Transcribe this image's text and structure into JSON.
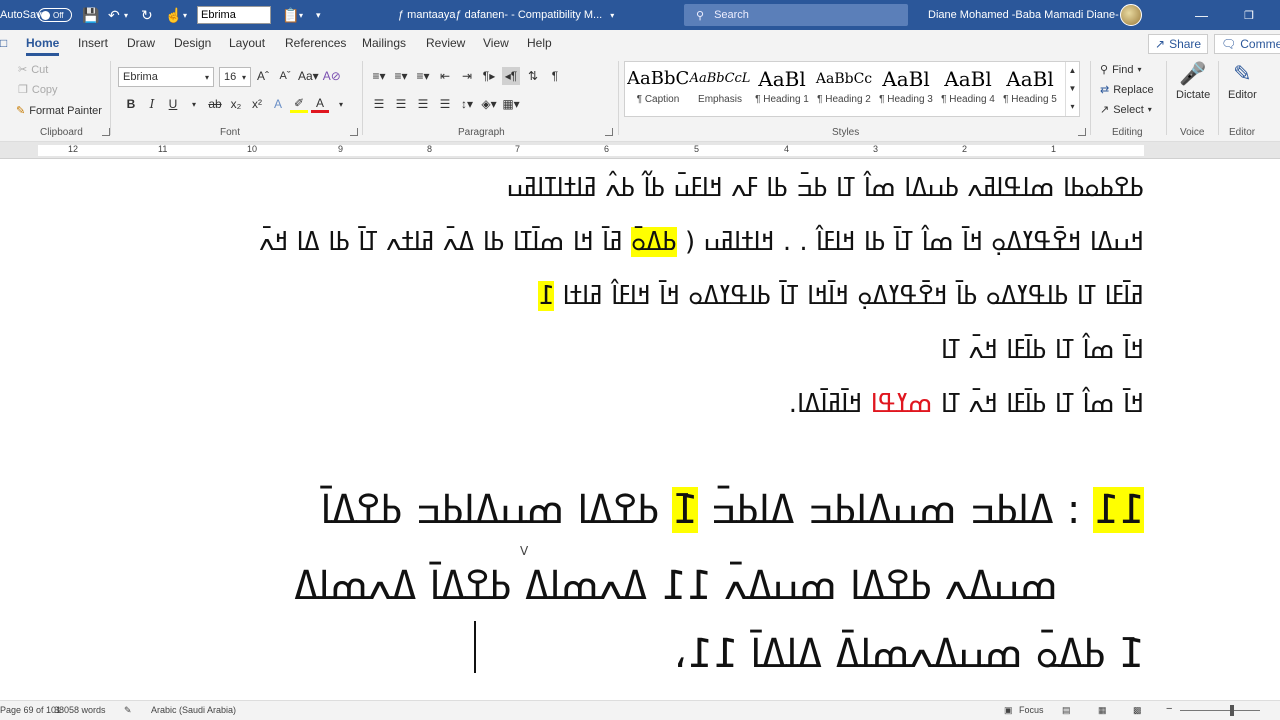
{
  "titlebar": {
    "autosave_label": "AutoSave",
    "autosave_state": "Off",
    "font_box": "Ebrima",
    "doc_title": "ƒ mantaayaƒ dafanen-  -  Compatibility M...",
    "search_placeholder": "Search",
    "user_name": "Diane Mohamed -Baba Mamadi Diane-"
  },
  "tabs": [
    "Home",
    "Insert",
    "Draw",
    "Design",
    "Layout",
    "References",
    "Mailings",
    "Review",
    "View",
    "Help"
  ],
  "share_label": "Share",
  "comments_label": "Comments",
  "clipboard": {
    "cut": "Cut",
    "copy": "Copy",
    "format_painter": "Format Painter",
    "group": "Clipboard"
  },
  "font": {
    "name": "Ebrima",
    "size": "16",
    "group": "Font"
  },
  "paragraph": {
    "group": "Paragraph"
  },
  "styles": {
    "group": "Styles",
    "items": [
      {
        "preview": "AaBbC",
        "name": "¶ Caption"
      },
      {
        "preview": "AaBbCcL",
        "name": "Emphasis"
      },
      {
        "preview": "AaBl",
        "name": "¶ Heading 1"
      },
      {
        "preview": "AaBbCc",
        "name": "¶ Heading 2"
      },
      {
        "preview": "AaBl",
        "name": "¶ Heading 3"
      },
      {
        "preview": "AaBl",
        "name": "¶ Heading 4"
      },
      {
        "preview": "AaBl",
        "name": "¶ Heading 5"
      }
    ]
  },
  "editing": {
    "find": "Find",
    "replace": "Replace",
    "select": "Select",
    "group": "Editing"
  },
  "voice": {
    "dictate": "Dictate",
    "group": "Voice"
  },
  "editor_group": {
    "editor": "Editor",
    "group": "Editor"
  },
  "ruler_numbers": [
    "12",
    "11",
    "10",
    "9",
    "8",
    "7",
    "6",
    "5",
    "4",
    "3",
    "2",
    "1"
  ],
  "document": {
    "para1": [
      "ߕߐߕߋߕߊ ߘߊߟߊߥߍ ߕߎߡߊ ߘߊ߮ ߠߊ ߕߏ߫ ߕߊ ߓߍ ߞߊߓߎ߫ ߕߊ߬ ߕߍ߮ ߥߊߙߊߠߊߥߎ",
      "ߞߎߡߊ ߞߐ߫ߟߌߡߋ߲ ߞߊ߫ ߘߊ߮ ߠߊ߫ ߕߊ ߞߊߓߊ߮ . . ߞߊߙߊߥߎ",
      "ߥߊ߫ ߞߊ ߘߊ߫ߠߊ ߕߊ ߡߍ߫ ߥߊߙߍ ߠߊ߫ ߕߊ ߡߊ ߞߍ߫",
      "ߥߊ߫ߓߊ ߠߊ ߕߊߟߌߡߋ ߕߊ߫ ߞߐ߫ߟߌߡߋ߲ ߞߊ߫ߞߊ ߠߊ߫ ߕߊߟߌߡߋ ߞߊ߫ ߞߊߓߊ߮ ߥߊߙߊ",
      "ߞߊ߫ ߘߊ߮ ߠߊ ߕߊ߫ߓߊ ߞߍ߫ ߠߊ"
    ],
    "para1_hl_1": "ߕߡߋ߫",
    "para1_hl_2": "߁",
    "para1_red": "ߘߌߟߊ",
    "para1_close": "ߞߊ߫ߥߊ߫ߡߊ.",
    "para2_line1_hl1": "߁߁",
    "para2_line1": ": ߡߊߕߏ ߘߎߡߊߕߏ ߡߊߕߏ߫",
    "para2_line1_hl2": "߁߫",
    "para2_line1_end": "ߕߐߡߊ ߘߎߡߊߕߏ ߕߐߡߊ߫",
    "para2_line2": "ߘߎߡߍ ߕߐߡߊ ߘߎߡߍ߫ ߁߁ ߡߍߘߊߡ ߕߐߡߊ߫ ߡߍߘߊߡ",
    "para2_line3": "߁߫  ߕߡߋ߫ ߘߎߡߍߘߊߡ߫  ߡߊߡߊ߫ ߁߁،"
  },
  "status": {
    "page": "Page 69 of 101",
    "words": "38058 words",
    "language": "Arabic (Saudi Arabia)",
    "focus": "Focus"
  }
}
